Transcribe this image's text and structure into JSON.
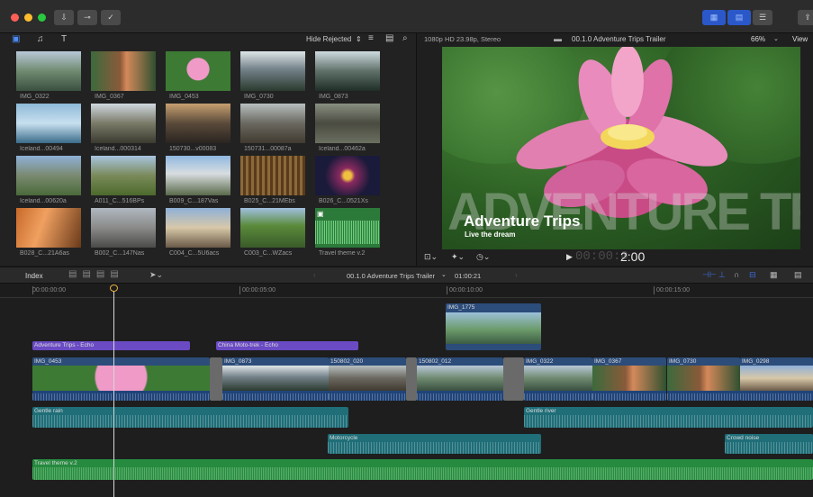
{
  "colors": {
    "accent": "#4d7df0",
    "connected": "#6a4bc4",
    "audio_teal": "#1f6e78",
    "music_green": "#268a3f",
    "playhead": "#d8d8d8"
  },
  "toolbar": {
    "import_icon": "download-icon",
    "keywords_icon": "key-icon",
    "background_tasks_icon": "checkmark-circle-icon"
  },
  "browser": {
    "filter_label": "Hide Rejected",
    "clips": [
      {
        "label": "IMG_0322",
        "scene": "river"
      },
      {
        "label": "IMG_0367",
        "scene": "person"
      },
      {
        "label": "IMG_0453",
        "scene": "lotus"
      },
      {
        "label": "IMG_0730",
        "scene": "karst"
      },
      {
        "label": "IMG_0873",
        "scene": "karst2"
      },
      {
        "label": "Iceland...00494",
        "scene": "ice"
      },
      {
        "label": "Iceland...000314",
        "scene": "coast"
      },
      {
        "label": "150730...v00083",
        "scene": "dusk"
      },
      {
        "label": "150731...00087a",
        "scene": "rocks"
      },
      {
        "label": "Iceland...00462a",
        "scene": "canyon"
      },
      {
        "label": "Iceland...00620a",
        "scene": "mount"
      },
      {
        "label": "A011_C...516BPs",
        "scene": "valley"
      },
      {
        "label": "B009_C...187Vas",
        "scene": "alps"
      },
      {
        "label": "B025_C...21MEbs",
        "scene": "stone"
      },
      {
        "label": "B026_C...0521Xs",
        "scene": "tunnel"
      },
      {
        "label": "B028_C...21A6as",
        "scene": "hall"
      },
      {
        "label": "B002_C...147Nas",
        "scene": "plaza"
      },
      {
        "label": "C004_C...5U6acs",
        "scene": "church"
      },
      {
        "label": "C003_C...WZacs",
        "scene": "trees"
      },
      {
        "label": "Travel theme v.2",
        "scene": "audio"
      }
    ]
  },
  "viewer": {
    "format": "1080p HD 23.98p, Stereo",
    "project": "00.1.0 Adventure Trips Trailer",
    "zoom": "66%",
    "view_menu": "View",
    "overlay_big": "ADVENTURE TRIPS",
    "title": "Adventure Trips",
    "subtitle": "Live the dream",
    "timecode_dim": "00:00:0",
    "timecode": "2:00"
  },
  "timeline": {
    "index_label": "Index",
    "project_name": "00.1.0 Adventure Trips Trailer",
    "duration": "01:00:21",
    "ruler": [
      "00:00:00:00",
      "00:00:05:00",
      "00:00:10:00",
      "00:00:15:00"
    ],
    "connected_video": "IMG_1775",
    "titles": [
      "Adventure Trips - Echo",
      "China Moto-trek - Echo"
    ],
    "primary_clips": [
      "IMG_0453",
      "IMG_0873",
      "150802_020",
      "150802_012",
      "IMG_0322",
      "IMG_0367",
      "IMG_0730",
      "IMG_0298"
    ],
    "audio_clips": [
      "Gentle rain",
      "Gentle river",
      "Motorcycle",
      "Crowd noise"
    ],
    "music": "Travel theme v.2"
  }
}
